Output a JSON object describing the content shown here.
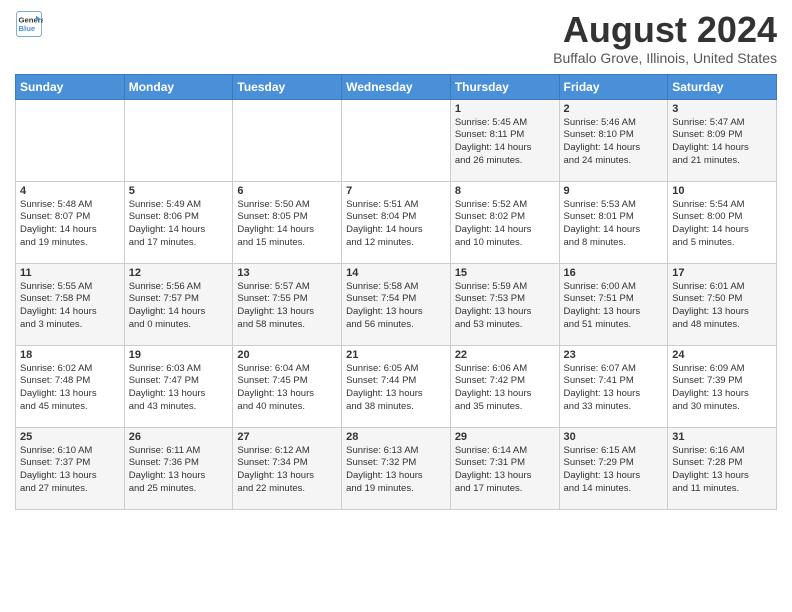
{
  "header": {
    "logo_line1": "General",
    "logo_line2": "Blue",
    "title": "August 2024",
    "subtitle": "Buffalo Grove, Illinois, United States"
  },
  "days_of_week": [
    "Sunday",
    "Monday",
    "Tuesday",
    "Wednesday",
    "Thursday",
    "Friday",
    "Saturday"
  ],
  "weeks": [
    [
      {
        "day": "",
        "info": ""
      },
      {
        "day": "",
        "info": ""
      },
      {
        "day": "",
        "info": ""
      },
      {
        "day": "",
        "info": ""
      },
      {
        "day": "1",
        "info": "Sunrise: 5:45 AM\nSunset: 8:11 PM\nDaylight: 14 hours\nand 26 minutes."
      },
      {
        "day": "2",
        "info": "Sunrise: 5:46 AM\nSunset: 8:10 PM\nDaylight: 14 hours\nand 24 minutes."
      },
      {
        "day": "3",
        "info": "Sunrise: 5:47 AM\nSunset: 8:09 PM\nDaylight: 14 hours\nand 21 minutes."
      }
    ],
    [
      {
        "day": "4",
        "info": "Sunrise: 5:48 AM\nSunset: 8:07 PM\nDaylight: 14 hours\nand 19 minutes."
      },
      {
        "day": "5",
        "info": "Sunrise: 5:49 AM\nSunset: 8:06 PM\nDaylight: 14 hours\nand 17 minutes."
      },
      {
        "day": "6",
        "info": "Sunrise: 5:50 AM\nSunset: 8:05 PM\nDaylight: 14 hours\nand 15 minutes."
      },
      {
        "day": "7",
        "info": "Sunrise: 5:51 AM\nSunset: 8:04 PM\nDaylight: 14 hours\nand 12 minutes."
      },
      {
        "day": "8",
        "info": "Sunrise: 5:52 AM\nSunset: 8:02 PM\nDaylight: 14 hours\nand 10 minutes."
      },
      {
        "day": "9",
        "info": "Sunrise: 5:53 AM\nSunset: 8:01 PM\nDaylight: 14 hours\nand 8 minutes."
      },
      {
        "day": "10",
        "info": "Sunrise: 5:54 AM\nSunset: 8:00 PM\nDaylight: 14 hours\nand 5 minutes."
      }
    ],
    [
      {
        "day": "11",
        "info": "Sunrise: 5:55 AM\nSunset: 7:58 PM\nDaylight: 14 hours\nand 3 minutes."
      },
      {
        "day": "12",
        "info": "Sunrise: 5:56 AM\nSunset: 7:57 PM\nDaylight: 14 hours\nand 0 minutes."
      },
      {
        "day": "13",
        "info": "Sunrise: 5:57 AM\nSunset: 7:55 PM\nDaylight: 13 hours\nand 58 minutes."
      },
      {
        "day": "14",
        "info": "Sunrise: 5:58 AM\nSunset: 7:54 PM\nDaylight: 13 hours\nand 56 minutes."
      },
      {
        "day": "15",
        "info": "Sunrise: 5:59 AM\nSunset: 7:53 PM\nDaylight: 13 hours\nand 53 minutes."
      },
      {
        "day": "16",
        "info": "Sunrise: 6:00 AM\nSunset: 7:51 PM\nDaylight: 13 hours\nand 51 minutes."
      },
      {
        "day": "17",
        "info": "Sunrise: 6:01 AM\nSunset: 7:50 PM\nDaylight: 13 hours\nand 48 minutes."
      }
    ],
    [
      {
        "day": "18",
        "info": "Sunrise: 6:02 AM\nSunset: 7:48 PM\nDaylight: 13 hours\nand 45 minutes."
      },
      {
        "day": "19",
        "info": "Sunrise: 6:03 AM\nSunset: 7:47 PM\nDaylight: 13 hours\nand 43 minutes."
      },
      {
        "day": "20",
        "info": "Sunrise: 6:04 AM\nSunset: 7:45 PM\nDaylight: 13 hours\nand 40 minutes."
      },
      {
        "day": "21",
        "info": "Sunrise: 6:05 AM\nSunset: 7:44 PM\nDaylight: 13 hours\nand 38 minutes."
      },
      {
        "day": "22",
        "info": "Sunrise: 6:06 AM\nSunset: 7:42 PM\nDaylight: 13 hours\nand 35 minutes."
      },
      {
        "day": "23",
        "info": "Sunrise: 6:07 AM\nSunset: 7:41 PM\nDaylight: 13 hours\nand 33 minutes."
      },
      {
        "day": "24",
        "info": "Sunrise: 6:09 AM\nSunset: 7:39 PM\nDaylight: 13 hours\nand 30 minutes."
      }
    ],
    [
      {
        "day": "25",
        "info": "Sunrise: 6:10 AM\nSunset: 7:37 PM\nDaylight: 13 hours\nand 27 minutes."
      },
      {
        "day": "26",
        "info": "Sunrise: 6:11 AM\nSunset: 7:36 PM\nDaylight: 13 hours\nand 25 minutes."
      },
      {
        "day": "27",
        "info": "Sunrise: 6:12 AM\nSunset: 7:34 PM\nDaylight: 13 hours\nand 22 minutes."
      },
      {
        "day": "28",
        "info": "Sunrise: 6:13 AM\nSunset: 7:32 PM\nDaylight: 13 hours\nand 19 minutes."
      },
      {
        "day": "29",
        "info": "Sunrise: 6:14 AM\nSunset: 7:31 PM\nDaylight: 13 hours\nand 17 minutes."
      },
      {
        "day": "30",
        "info": "Sunrise: 6:15 AM\nSunset: 7:29 PM\nDaylight: 13 hours\nand 14 minutes."
      },
      {
        "day": "31",
        "info": "Sunrise: 6:16 AM\nSunset: 7:28 PM\nDaylight: 13 hours\nand 11 minutes."
      }
    ]
  ]
}
